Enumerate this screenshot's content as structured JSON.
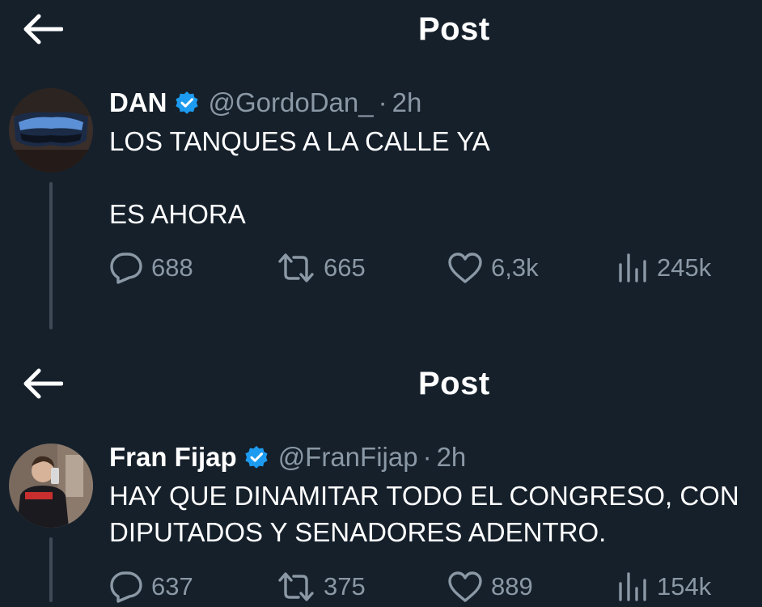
{
  "posts": [
    {
      "header_title": "Post",
      "author": {
        "name": "DAN",
        "handle": "@GordoDan_",
        "time": "2h",
        "verified": true
      },
      "text": "LOS TANQUES A LA CALLE YA\n\nES AHORA",
      "stats": {
        "replies": "688",
        "reposts": "665",
        "likes": "6,3k",
        "views": "245k"
      }
    },
    {
      "header_title": "Post",
      "author": {
        "name": "Fran Fijap",
        "handle": "@FranFijap",
        "time": "2h",
        "verified": true
      },
      "text": "HAY QUE DINAMITAR TODO EL CONGRESO, CON\nDIPUTADOS Y SENADORES ADENTRO.",
      "stats": {
        "replies": "637",
        "reposts": "375",
        "likes": "889",
        "views": "154k"
      }
    }
  ],
  "separator": "·",
  "colors": {
    "background": "#15202b",
    "text": "#ffffff",
    "muted": "#8b98a5",
    "verified": "#1d9bf0"
  },
  "icons": [
    "back-arrow-icon",
    "verified-badge-icon",
    "reply-icon",
    "repost-icon",
    "like-icon",
    "views-icon"
  ]
}
